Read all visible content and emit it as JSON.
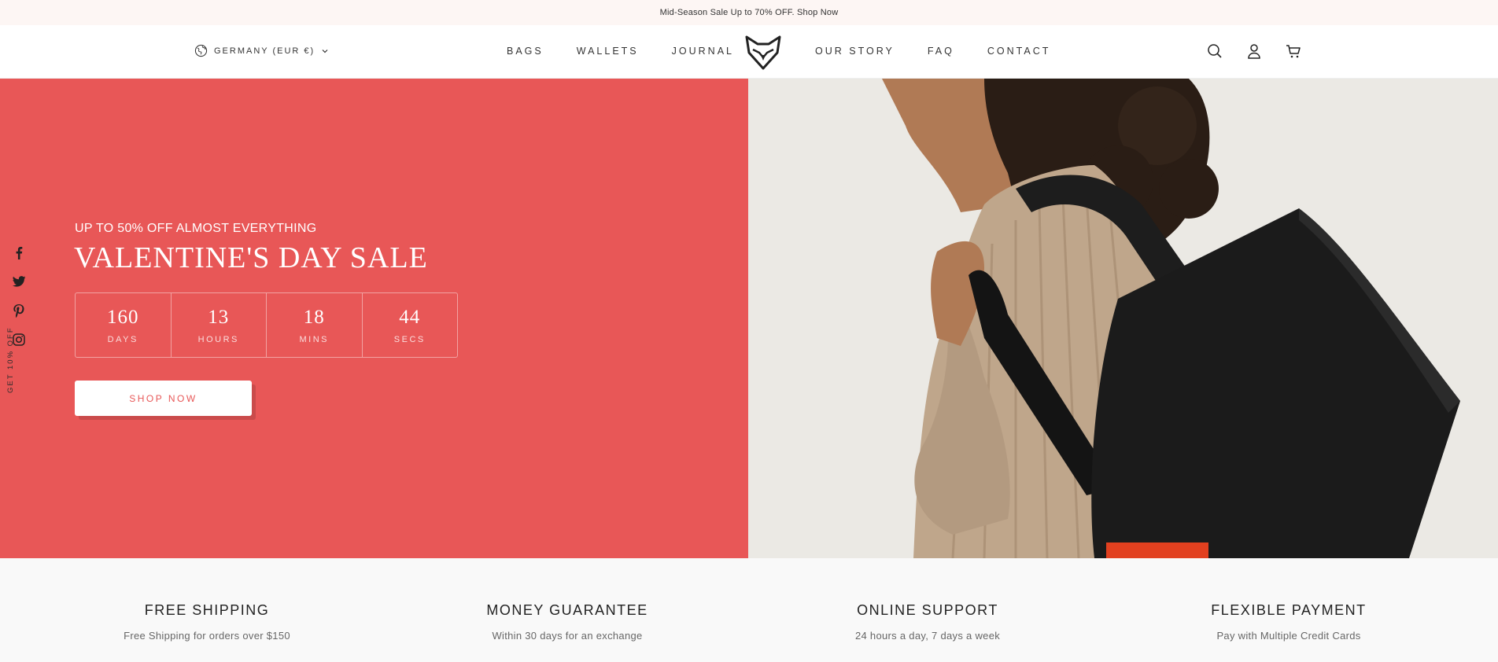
{
  "announcement": {
    "text": "Mid-Season Sale Up to 70% OFF. Shop Now"
  },
  "header": {
    "locale": "GERMANY (EUR €)",
    "nav_left": [
      "BAGS",
      "WALLETS",
      "JOURNAL"
    ],
    "nav_right": [
      "OUR STORY",
      "FAQ",
      "CONTACT"
    ],
    "logo_icon": "fox-head-logo-icon",
    "icons": [
      "search-icon",
      "account-icon",
      "cart-icon"
    ]
  },
  "social": {
    "icons": [
      "facebook-icon",
      "twitter-icon",
      "pinterest-icon",
      "instagram-icon"
    ],
    "promo_label": "GET 10% OFF"
  },
  "hero": {
    "eyebrow": "UP TO 50% OFF ALMOST EVERYTHING",
    "title": "VALENTINE'S DAY SALE",
    "countdown": [
      {
        "value": "160",
        "label": "DAYS"
      },
      {
        "value": "13",
        "label": "HOURS"
      },
      {
        "value": "18",
        "label": "MINS"
      },
      {
        "value": "44",
        "label": "SECS"
      }
    ],
    "cta": "SHOP NOW",
    "accent_color": "#e85757"
  },
  "features": [
    {
      "title": "FREE SHIPPING",
      "subtitle": "Free Shipping for orders over $150"
    },
    {
      "title": "MONEY GUARANTEE",
      "subtitle": "Within 30 days for an exchange"
    },
    {
      "title": "ONLINE SUPPORT",
      "subtitle": "24 hours a day, 7 days a week"
    },
    {
      "title": "FLEXIBLE PAYMENT",
      "subtitle": "Pay with Multiple Credit Cards"
    }
  ]
}
